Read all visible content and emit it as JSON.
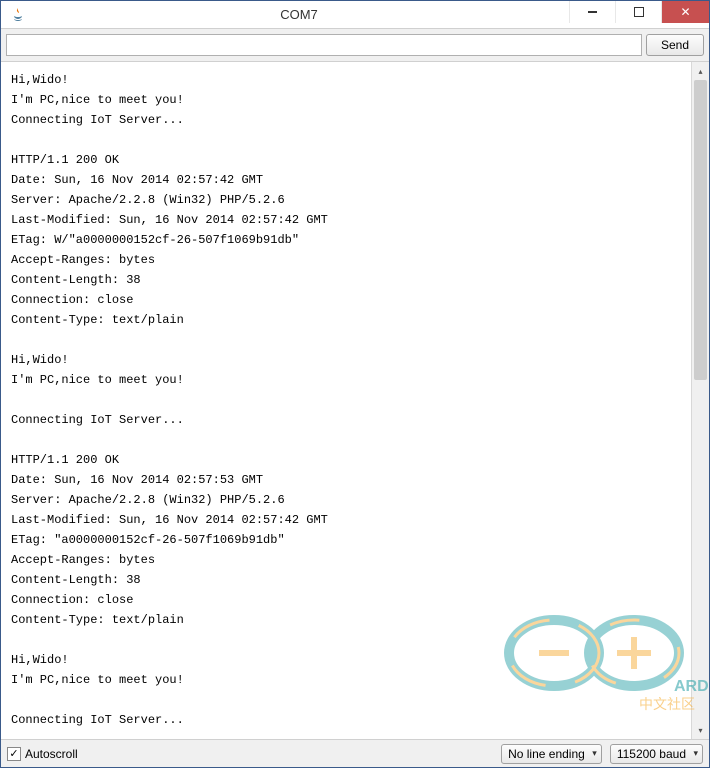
{
  "window": {
    "title": "COM7"
  },
  "toolbar": {
    "input_value": "",
    "input_placeholder": "",
    "send_label": "Send"
  },
  "console_text": "Hi,Wido!\nI'm PC,nice to meet you!\nConnecting IoT Server...\n\nHTTP/1.1 200 OK\nDate: Sun, 16 Nov 2014 02:57:42 GMT\nServer: Apache/2.2.8 (Win32) PHP/5.2.6\nLast-Modified: Sun, 16 Nov 2014 02:57:42 GMT\nETag: W/\"a0000000152cf-26-507f1069b91db\"\nAccept-Ranges: bytes\nContent-Length: 38\nConnection: close\nContent-Type: text/plain\n\nHi,Wido!\nI'm PC,nice to meet you!\n\nConnecting IoT Server...\n\nHTTP/1.1 200 OK\nDate: Sun, 16 Nov 2014 02:57:53 GMT\nServer: Apache/2.2.8 (Win32) PHP/5.2.6\nLast-Modified: Sun, 16 Nov 2014 02:57:42 GMT\nETag: \"a0000000152cf-26-507f1069b91db\"\nAccept-Ranges: bytes\nContent-Length: 38\nConnection: close\nContent-Type: text/plain\n\nHi,Wido!\nI'm PC,nice to meet you!\n\nConnecting IoT Server...\n",
  "statusbar": {
    "autoscroll_checked": true,
    "autoscroll_label": "Autoscroll",
    "line_ending": "No line ending",
    "baud": "115200 baud"
  },
  "watermark": {
    "text": "ARDUINO",
    "subtext": "中文社区"
  }
}
